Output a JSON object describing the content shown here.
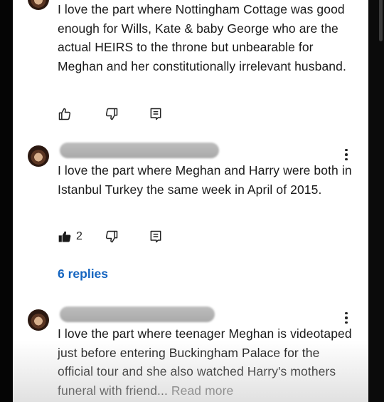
{
  "comments": [
    {
      "text": "I love the part where Nottingham Cottage was good enough for Wills, Kate & baby George who are the actual HEIRS to the throne but unbearable for Meghan and her constitutionally irrelevant husband."
    },
    {
      "text": "I love the part where Meghan and Harry were both in Istanbul Turkey the same week in April of 2015.",
      "like_count": "2",
      "replies_label": "6 replies"
    },
    {
      "text": "I love the part where teenager Meghan is videotaped just before entering Buckingham Palace for the official tour and she also watched Harry's mothers funeral with friend...",
      "read_more": "Read more"
    }
  ],
  "icons": {
    "like": "thumbs-up-icon",
    "like_filled": "thumbs-up-filled-icon",
    "dislike": "thumbs-down-icon",
    "reply": "reply-icon",
    "more": "more-vertical-icon"
  },
  "colors": {
    "text": "#1a1a1a",
    "link": "#1565c0",
    "read_more": "#606060",
    "background": "#ffffff"
  }
}
